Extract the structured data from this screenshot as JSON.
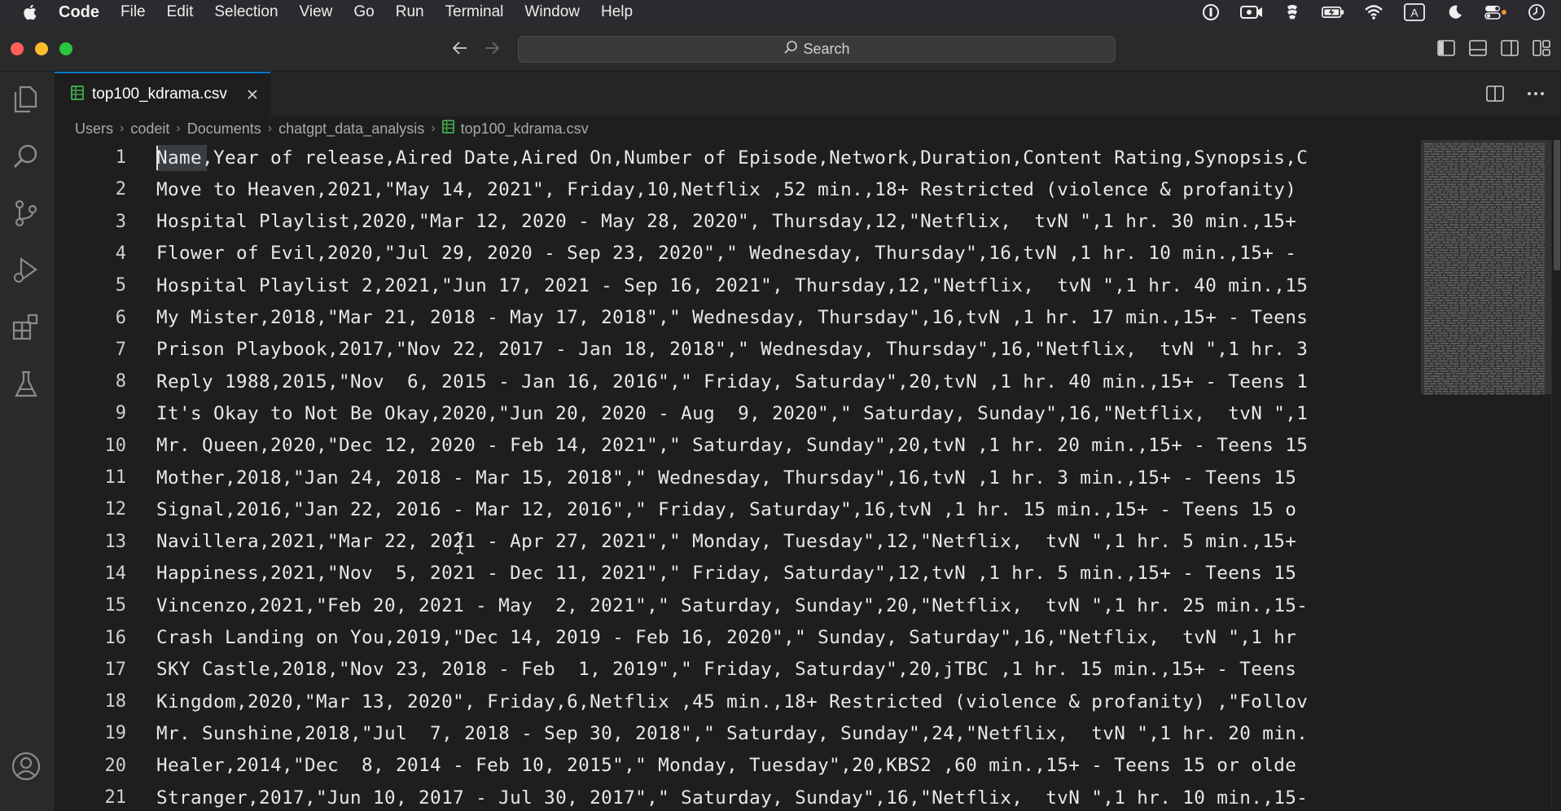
{
  "menubar": {
    "app": "Code",
    "items": [
      "File",
      "Edit",
      "Selection",
      "View",
      "Go",
      "Run",
      "Terminal",
      "Window",
      "Help"
    ]
  },
  "titlebar": {
    "search_label": "Search"
  },
  "tab": {
    "label": "top100_kdrama.csv"
  },
  "breadcrumb": [
    "Users",
    "codeit",
    "Documents",
    "chatgpt_data_analysis",
    "top100_kdrama.csv"
  ],
  "editor": {
    "lines": [
      {
        "n": "1",
        "text": "Name,Year of release,Aired Date,Aired On,Number of Episode,Network,Duration,Content Rating,Synopsis,C"
      },
      {
        "n": "2",
        "text": "Move to Heaven,2021,\"May 14, 2021\", Friday,10,Netflix ,52 min.,18+ Restricted (violence & profanity)"
      },
      {
        "n": "3",
        "text": "Hospital Playlist,2020,\"Mar 12, 2020 - May 28, 2020\", Thursday,12,\"Netflix,  tvN \",1 hr. 30 min.,15+"
      },
      {
        "n": "4",
        "text": "Flower of Evil,2020,\"Jul 29, 2020 - Sep 23, 2020\",\" Wednesday, Thursday\",16,tvN ,1 hr. 10 min.,15+ -"
      },
      {
        "n": "5",
        "text": "Hospital Playlist 2,2021,\"Jun 17, 2021 - Sep 16, 2021\", Thursday,12,\"Netflix,  tvN \",1 hr. 40 min.,15"
      },
      {
        "n": "6",
        "text": "My Mister,2018,\"Mar 21, 2018 - May 17, 2018\",\" Wednesday, Thursday\",16,tvN ,1 hr. 17 min.,15+ - Teens"
      },
      {
        "n": "7",
        "text": "Prison Playbook,2017,\"Nov 22, 2017 - Jan 18, 2018\",\" Wednesday, Thursday\",16,\"Netflix,  tvN \",1 hr. 3"
      },
      {
        "n": "8",
        "text": "Reply 1988,2015,\"Nov  6, 2015 - Jan 16, 2016\",\" Friday, Saturday\",20,tvN ,1 hr. 40 min.,15+ - Teens 1"
      },
      {
        "n": "9",
        "text": "It's Okay to Not Be Okay,2020,\"Jun 20, 2020 - Aug  9, 2020\",\" Saturday, Sunday\",16,\"Netflix,  tvN \",1"
      },
      {
        "n": "10",
        "text": "Mr. Queen,2020,\"Dec 12, 2020 - Feb 14, 2021\",\" Saturday, Sunday\",20,tvN ,1 hr. 20 min.,15+ - Teens 15"
      },
      {
        "n": "11",
        "text": "Mother,2018,\"Jan 24, 2018 - Mar 15, 2018\",\" Wednesday, Thursday\",16,tvN ,1 hr. 3 min.,15+ - Teens 15"
      },
      {
        "n": "12",
        "text": "Signal,2016,\"Jan 22, 2016 - Mar 12, 2016\",\" Friday, Saturday\",16,tvN ,1 hr. 15 min.,15+ - Teens 15 o"
      },
      {
        "n": "13",
        "text": "Navillera,2021,\"Mar 22, 2021 - Apr 27, 2021\",\" Monday, Tuesday\",12,\"Netflix,  tvN \",1 hr. 5 min.,15+"
      },
      {
        "n": "14",
        "text": "Happiness,2021,\"Nov  5, 2021 - Dec 11, 2021\",\" Friday, Saturday\",12,tvN ,1 hr. 5 min.,15+ - Teens 15"
      },
      {
        "n": "15",
        "text": "Vincenzo,2021,\"Feb 20, 2021 - May  2, 2021\",\" Saturday, Sunday\",20,\"Netflix,  tvN \",1 hr. 25 min.,15-"
      },
      {
        "n": "16",
        "text": "Crash Landing on You,2019,\"Dec 14, 2019 - Feb 16, 2020\",\" Sunday, Saturday\",16,\"Netflix,  tvN \",1 hr"
      },
      {
        "n": "17",
        "text": "SKY Castle,2018,\"Nov 23, 2018 - Feb  1, 2019\",\" Friday, Saturday\",20,jTBC ,1 hr. 15 min.,15+ - Teens"
      },
      {
        "n": "18",
        "text": "Kingdom,2020,\"Mar 13, 2020\", Friday,6,Netflix ,45 min.,18+ Restricted (violence & profanity) ,\"Follov"
      },
      {
        "n": "19",
        "text": "Mr. Sunshine,2018,\"Jul  7, 2018 - Sep 30, 2018\",\" Saturday, Sunday\",24,\"Netflix,  tvN \",1 hr. 20 min."
      },
      {
        "n": "20",
        "text": "Healer,2014,\"Dec  8, 2014 - Feb 10, 2015\",\" Monday, Tuesday\",20,KBS2 ,60 min.,15+ - Teens 15 or olde"
      },
      {
        "n": "21",
        "text": "Stranger,2017,\"Jun 10, 2017 - Jul 30, 2017\",\" Saturday, Sunday\",16,\"Netflix,  tvN \",1 hr. 10 min.,15-"
      }
    ]
  },
  "colors": {
    "accent": "#007acc",
    "csv_icon": "#3fa34d"
  }
}
